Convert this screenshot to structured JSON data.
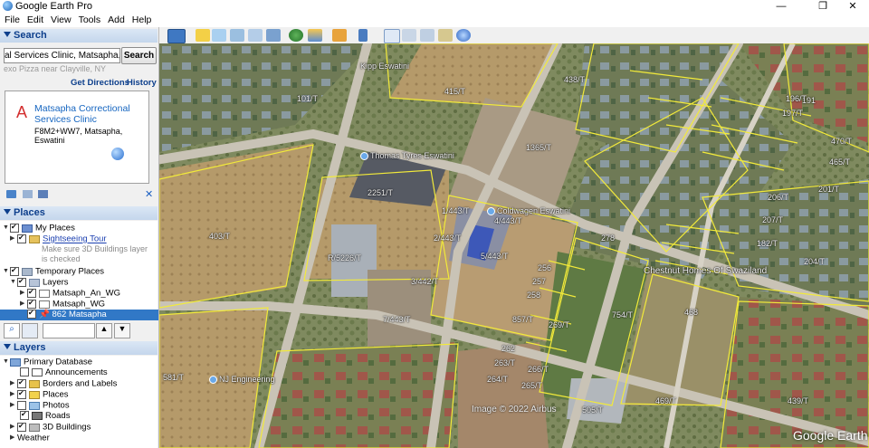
{
  "window": {
    "title": "Google Earth Pro",
    "minimize": "—",
    "maximize": "❐",
    "close": "✕"
  },
  "menu": [
    "File",
    "Edit",
    "View",
    "Tools",
    "Add",
    "Help"
  ],
  "search": {
    "header": "Search",
    "value": "al Services Clinic, Matsapha, Eswatini",
    "button": "Search",
    "hint": "exo Pizza near Clayville, NY",
    "directions": "Get Directions",
    "history": "History",
    "result": {
      "letter": "A",
      "name": "Matsapha Correctional Services Clinic",
      "address": "F8M2+WW7, Matsapha, Eswatini"
    }
  },
  "places": {
    "header": "Places",
    "items": {
      "my_places": "My Places",
      "sightseeing": "Sightseeing Tour",
      "hint": "Make sure 3D Buildings layer is checked",
      "temporary": "Temporary Places",
      "layers": "Layers",
      "matsapha_an": "Matsaph_An_WG",
      "matsapha_wg": "Matsaph_WG",
      "selected": "862 Matsapha"
    }
  },
  "layers": {
    "header": "Layers",
    "items": {
      "primary": "Primary Database",
      "announcements": "Announcements",
      "borders": "Borders and Labels",
      "places": "Places",
      "photos": "Photos",
      "roads": "Roads",
      "buildings": "3D Buildings",
      "weather": "Weather"
    }
  },
  "map": {
    "labels": {
      "thomas": "Thomas Tyres Eswatini",
      "coldwagen": "Coldwagen Eswatini",
      "chestnut": "Chestnut Homes Of Swaziland",
      "nj": "NJ Engineering",
      "kipp": "Kipp Eswatini",
      "credit": "Image © 2022 Airbus",
      "watermark": "Google Earth"
    },
    "parcels": {
      "p101": "101/T",
      "p415": "415/T",
      "p438": "438/T",
      "p1365": "1365/T",
      "p1403": "403/T",
      "p2251": "2251/T",
      "p2443": "2/443/T",
      "p1443": "1/443/T",
      "p4443": "4/443/T",
      "p5443": "5/443/T",
      "p3442": "3/442/T",
      "p7443": "7/443/T",
      "p5226": "R/5226/T",
      "p257": "257",
      "p258": "258",
      "p256": "256",
      "p857": "857/T",
      "p269": "269/T",
      "p262": "262",
      "p263": "263/T",
      "p264": "264/T",
      "p266": "266/T",
      "p265": "265/T",
      "p505": "505/T",
      "p469": "469/T",
      "p754": "754/T",
      "p581": "581/T",
      "p468": "468",
      "p439": "439/T",
      "p207": "207/T",
      "p206": "206/T",
      "p204": "204/T",
      "p182": "182/T",
      "p201": "201/T",
      "p191": "191",
      "p465": "465/T",
      "p470": "470/T",
      "p197": "197/T",
      "p196": "196/T",
      "p278": "278"
    }
  }
}
